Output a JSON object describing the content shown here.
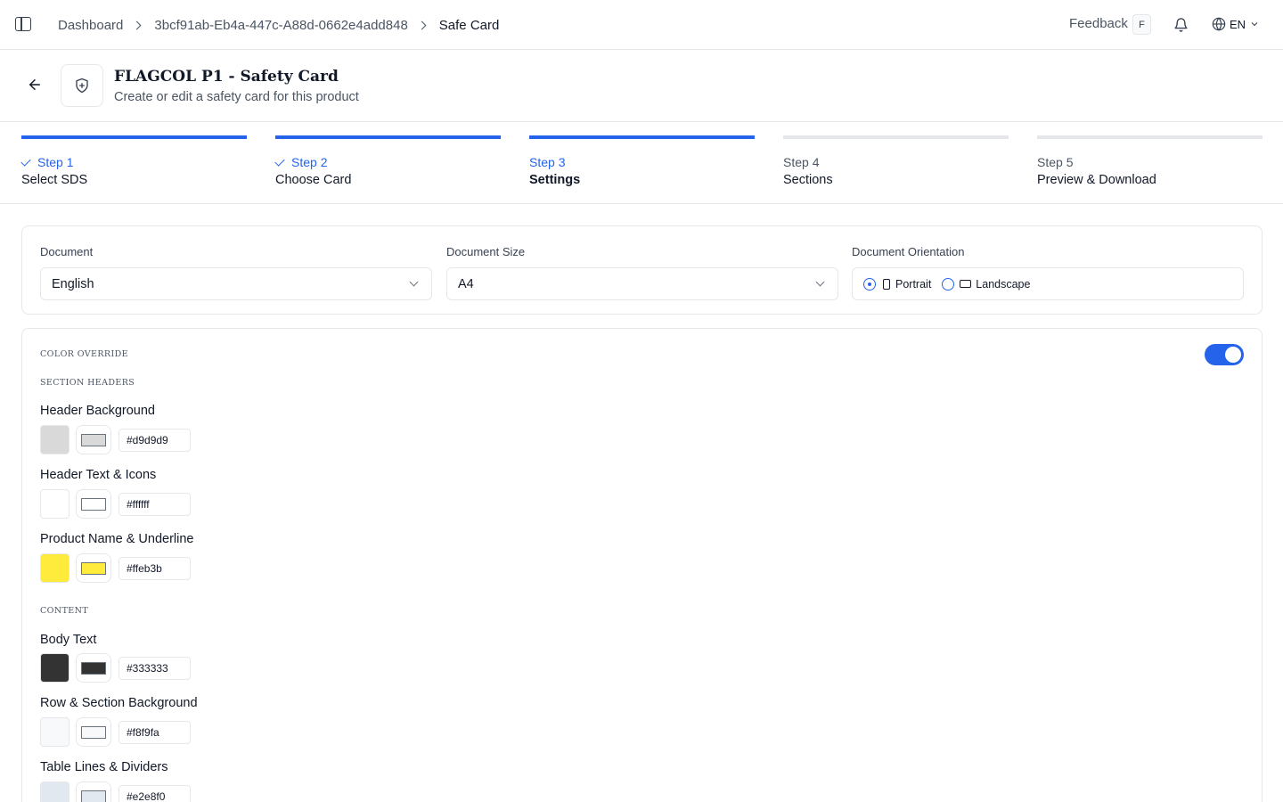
{
  "breadcrumb": {
    "items": [
      "Dashboard",
      "3bcf91ab-Eb4a-447c-A88d-0662e4add848",
      "Safe Card"
    ]
  },
  "topbar": {
    "feedback_label": "Feedback",
    "feedback_shortcut": "F",
    "language": "EN"
  },
  "header": {
    "title": "FLAGCOL P1 - Safety Card",
    "subtitle": "Create or edit a safety card for this product"
  },
  "steps": [
    {
      "num": "Step 1",
      "label": "Select SDS",
      "status": "complete"
    },
    {
      "num": "Step 2",
      "label": "Choose Card",
      "status": "complete"
    },
    {
      "num": "Step 3",
      "label": "Settings",
      "status": "current"
    },
    {
      "num": "Step 4",
      "label": "Sections",
      "status": "upcoming"
    },
    {
      "num": "Step 5",
      "label": "Preview & Download",
      "status": "upcoming"
    }
  ],
  "document_settings": {
    "document_label": "Document",
    "document_value": "English",
    "size_label": "Document Size",
    "size_value": "A4",
    "orientation_label": "Document Orientation",
    "orientation_options": [
      "Portrait",
      "Landscape"
    ],
    "orientation_selected": "Portrait"
  },
  "color_override": {
    "title": "COLOR OVERRIDE",
    "enabled": true,
    "section_headers_title": "SECTION HEADERS",
    "content_title": "CONTENT",
    "colors": [
      {
        "label": "Header Background",
        "hex": "#d9d9d9"
      },
      {
        "label": "Header Text & Icons",
        "hex": "#ffffff"
      },
      {
        "label": "Product Name & Underline",
        "hex": "#ffeb3b"
      },
      {
        "label": "Body Text",
        "hex": "#333333"
      },
      {
        "label": "Row & Section Background",
        "hex": "#f8f9fa"
      },
      {
        "label": "Table Lines & Dividers",
        "hex": "#e2e8f0"
      }
    ]
  },
  "colors": {
    "accent": "#2563eb",
    "border": "#e5e7eb"
  }
}
